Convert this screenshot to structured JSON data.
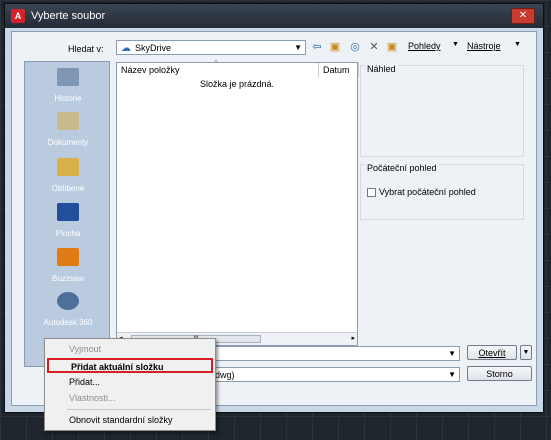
{
  "window": {
    "title": "Vyberte soubor",
    "close_glyph": "✕",
    "app_icon_glyph": "A"
  },
  "toolbar": {
    "look_in_label": "Hledat v:",
    "look_in_value": "SkyDrive",
    "views_label": "Pohledy",
    "tools_label": "Nástroje"
  },
  "places": [
    {
      "label": "Historie",
      "icon": "history-icon",
      "color": "#7f96b4"
    },
    {
      "label": "Dokumenty",
      "icon": "documents-icon",
      "color": "#c8b98f"
    },
    {
      "label": "Oblíbené",
      "icon": "favorites-icon",
      "color": "#d8b049"
    },
    {
      "label": "Plocha",
      "icon": "desktop-icon",
      "color": "#214f9c"
    },
    {
      "label": "Buzzsaw",
      "icon": "buzzsaw-icon",
      "color": "#e07a12"
    },
    {
      "label": "Autodesk 360",
      "icon": "autodesk-360-icon",
      "color": "#4d6f99"
    }
  ],
  "filelist": {
    "col_name": "Název položky",
    "col_date": "Datum",
    "empty_message": "Složka je prázdná.",
    "scroll_thumb": "III"
  },
  "preview": {
    "title": "Náhled"
  },
  "initial_view": {
    "title": "Počáteční pohled",
    "checkbox_label": "Vybrat počáteční pohled",
    "checked": false
  },
  "buttons": {
    "open_label": "Otevřít",
    "cancel_label": "Storno",
    "open_dropdown": "▼"
  },
  "filetype": {
    "visible_text": "dwg)"
  },
  "context_menu": {
    "items": [
      {
        "label": "Vyjmout",
        "disabled": true
      },
      {
        "label": "Přidat aktuální složku",
        "disabled": false,
        "highlighted": true
      },
      {
        "label": "Přidat...",
        "disabled": false
      },
      {
        "label": "Vlastnosti...",
        "disabled": true
      },
      {
        "label": "Obnovit standardní složky",
        "disabled": false
      }
    ],
    "highlight_color": "#d91c25"
  }
}
